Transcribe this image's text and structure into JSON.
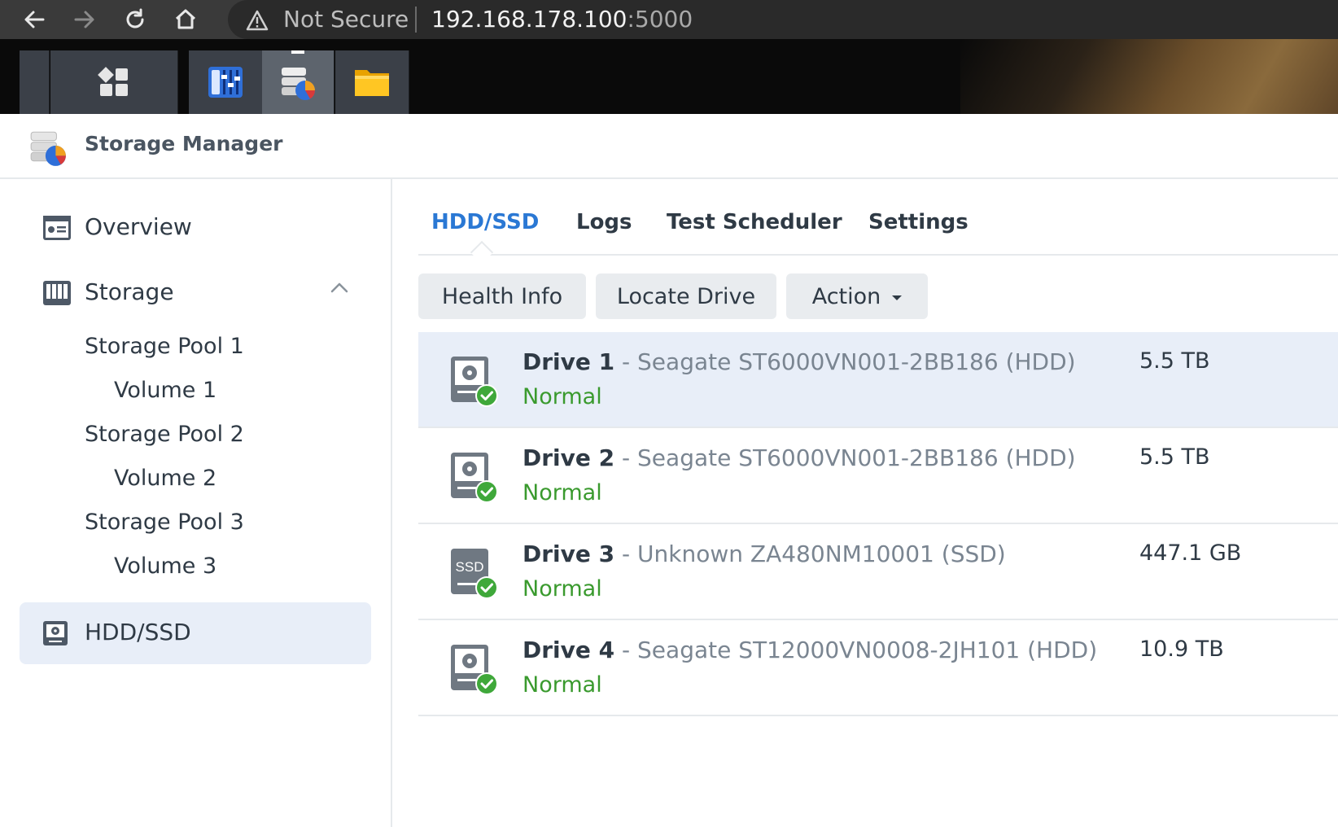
{
  "browser": {
    "security_label": "Not Secure",
    "url_host": "192.168.178.100",
    "url_port": ":5000"
  },
  "app": {
    "title": "Storage Manager"
  },
  "sidebar": {
    "items": [
      {
        "label": "Overview",
        "icon": "overview-icon"
      },
      {
        "label": "Storage",
        "icon": "storage-icon",
        "expanded": true
      },
      {
        "label": "HDD/SSD",
        "icon": "hdd-icon",
        "selected": true
      }
    ],
    "storage_children": [
      {
        "label": "Storage Pool 1"
      },
      {
        "label": "Volume 1"
      },
      {
        "label": "Storage Pool 2"
      },
      {
        "label": "Volume 2"
      },
      {
        "label": "Storage Pool 3"
      },
      {
        "label": "Volume 3"
      }
    ]
  },
  "tabs": [
    {
      "label": "HDD/SSD",
      "active": true
    },
    {
      "label": "Logs"
    },
    {
      "label": "Test Scheduler"
    },
    {
      "label": "Settings"
    }
  ],
  "toolbar": {
    "health_info": "Health Info",
    "locate_drive": "Locate Drive",
    "action": "Action"
  },
  "drives": [
    {
      "name": "Drive 1",
      "model": " - Seagate ST6000VN001-2BB186 (HDD)",
      "status": "Normal",
      "size": "5.5 TB",
      "type": "HDD",
      "selected": true
    },
    {
      "name": "Drive 2",
      "model": " - Seagate ST6000VN001-2BB186 (HDD)",
      "status": "Normal",
      "size": "5.5 TB",
      "type": "HDD"
    },
    {
      "name": "Drive 3",
      "model": " - Unknown ZA480NM10001 (SSD)",
      "status": "Normal",
      "size": "447.1 GB",
      "type": "SSD",
      "ssd_label": "SSD"
    },
    {
      "name": "Drive 4",
      "model": " - Seagate ST12000VN0008-2JH101 (HDD)",
      "status": "Normal",
      "size": "10.9 TB",
      "type": "HDD"
    }
  ],
  "colors": {
    "accent": "#2a78d4",
    "status_ok": "#3a9a2e",
    "selected_bg": "#e8eef8"
  }
}
